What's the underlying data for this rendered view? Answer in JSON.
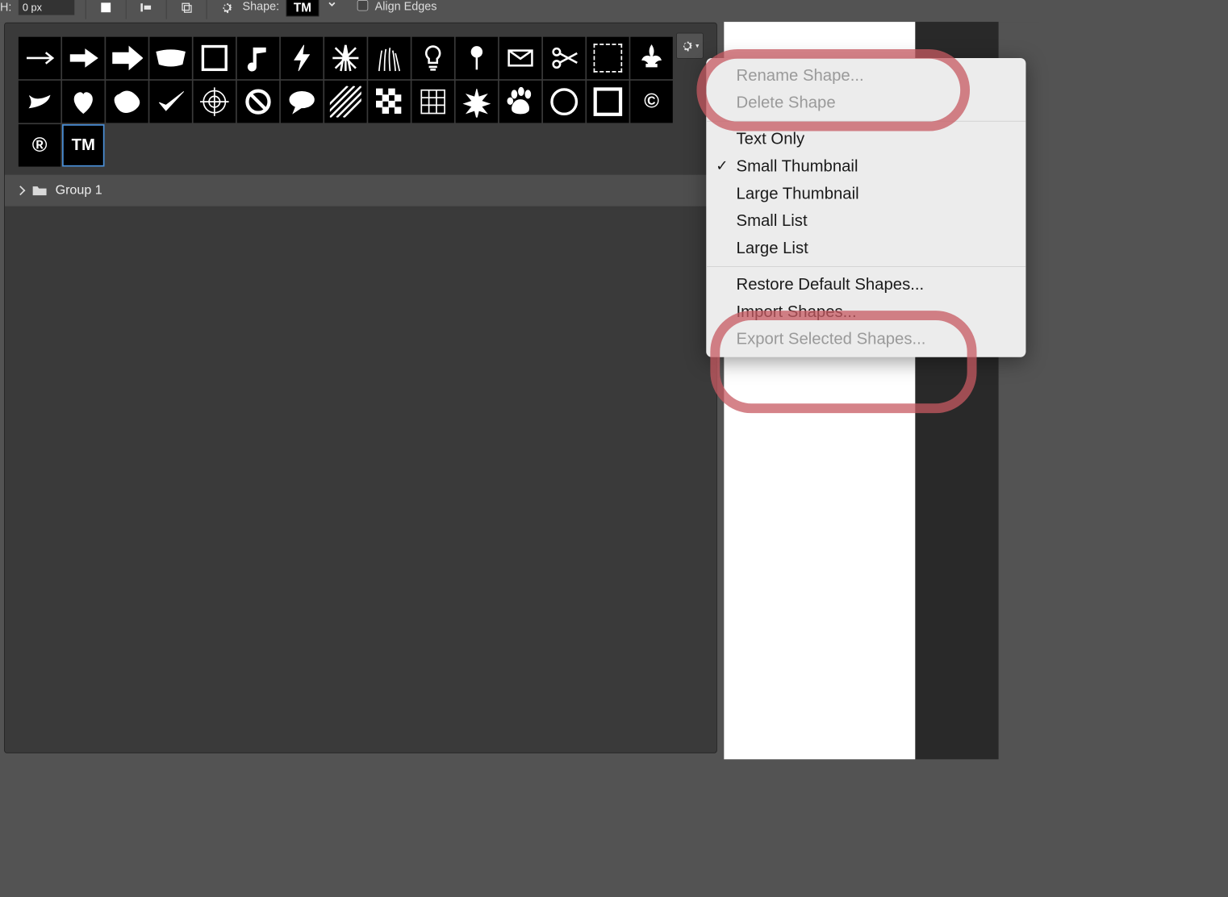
{
  "options_bar": {
    "h_label": "H:",
    "h_value": "0 px",
    "shape_label": "Shape:",
    "shape_preview_text": "TM",
    "align_edges_label": "Align Edges"
  },
  "panel": {
    "shapes": [
      {
        "name": "arrow-thin-right"
      },
      {
        "name": "arrow-medium-right"
      },
      {
        "name": "arrow-bold-right"
      },
      {
        "name": "banner"
      },
      {
        "name": "rough-frame"
      },
      {
        "name": "eighth-note"
      },
      {
        "name": "lightning"
      },
      {
        "name": "starburst"
      },
      {
        "name": "grass"
      },
      {
        "name": "lightbulb"
      },
      {
        "name": "pushpin"
      },
      {
        "name": "envelope"
      },
      {
        "name": "scissors"
      },
      {
        "name": "stamp-dashed"
      },
      {
        "name": "fleur-de-lis"
      },
      {
        "name": "ribbon"
      },
      {
        "name": "heart"
      },
      {
        "name": "blob"
      },
      {
        "name": "checkmark"
      },
      {
        "name": "target"
      },
      {
        "name": "no-symbol"
      },
      {
        "name": "speech-bubble"
      },
      {
        "name": "diagonal-lines"
      },
      {
        "name": "checker"
      },
      {
        "name": "grid"
      },
      {
        "name": "spark"
      },
      {
        "name": "paw"
      },
      {
        "name": "circle"
      },
      {
        "name": "square-outline"
      },
      {
        "name": "copyright",
        "text": "©"
      },
      {
        "name": "registered",
        "text": "®"
      },
      {
        "name": "trademark",
        "text": "TM"
      }
    ],
    "group_label": "Group 1"
  },
  "menu": {
    "items": [
      {
        "label": "Rename Shape...",
        "disabled": true
      },
      {
        "label": "Delete Shape",
        "disabled": true
      },
      {
        "divider": true
      },
      {
        "label": "Text Only"
      },
      {
        "label": "Small Thumbnail",
        "checked": true
      },
      {
        "label": "Large Thumbnail"
      },
      {
        "label": "Small List"
      },
      {
        "label": "Large List"
      },
      {
        "divider": true
      },
      {
        "label": "Restore Default Shapes..."
      },
      {
        "label": "Import Shapes..."
      },
      {
        "label": "Export Selected Shapes...",
        "disabled": true
      }
    ]
  }
}
